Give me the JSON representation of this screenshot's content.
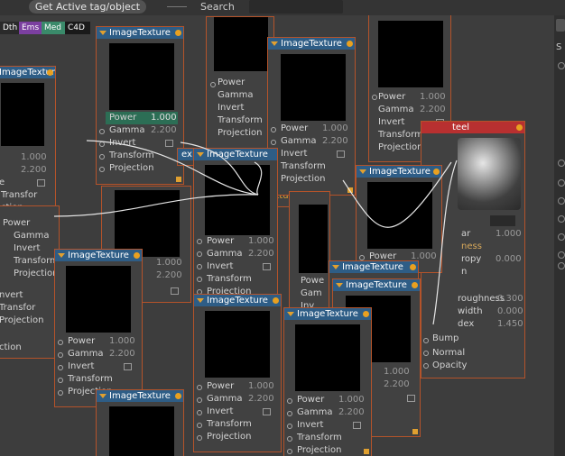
{
  "toolbar": {
    "get_active_label": "Get Active tag/object",
    "search_label": "Search",
    "search_value": ""
  },
  "tags": [
    {
      "label": "Dth",
      "color": "#2a2a2a"
    },
    {
      "label": "Ems",
      "color": "#7b3fa0"
    },
    {
      "label": "Med",
      "color": "#3a8a6a"
    },
    {
      "label": "C4D",
      "color": "#1a1a1a"
    }
  ],
  "right_dock": {
    "label": "S"
  },
  "image_texture": {
    "title": "ImageTexture",
    "power_label": "Power",
    "power_value": "1.000",
    "gamma_label": "Gamma",
    "gamma_value": "2.200",
    "invert_label": "Invert",
    "transform_label": "Transform",
    "projection_label": "Projection"
  },
  "material_node": {
    "title_partial": "teel",
    "rows": [
      "ar",
      "ness",
      "ropy",
      "n",
      "roughness",
      "width",
      "dex",
      "Bump",
      "Normal",
      "Opacity"
    ],
    "values": [
      "1.000",
      "0.000",
      "0.300",
      "0.000",
      "1.450"
    ]
  },
  "partial_labels": {
    "texture": "Texture",
    "ex": "ex",
    "d": "D",
    "power_short": "Powe",
    "gamma_short": "Gam",
    "invert_short": "Inv",
    "transform_short": "Tra",
    "projection_short": "Pro",
    "projection_partial": "ction",
    "invert_partial": "nvert",
    "transform_partial": "Transfor",
    "projection_partial2": "Projection",
    "a": "a",
    "e": "e",
    "n": "n",
    "p": "P",
    "s": "S"
  },
  "colors": {
    "header_blue": "#2e5d86",
    "header_red": "#b83030",
    "node_border": "#b4532a",
    "port_orange": "#e8a020",
    "highlight_green": "#2c6e55"
  }
}
